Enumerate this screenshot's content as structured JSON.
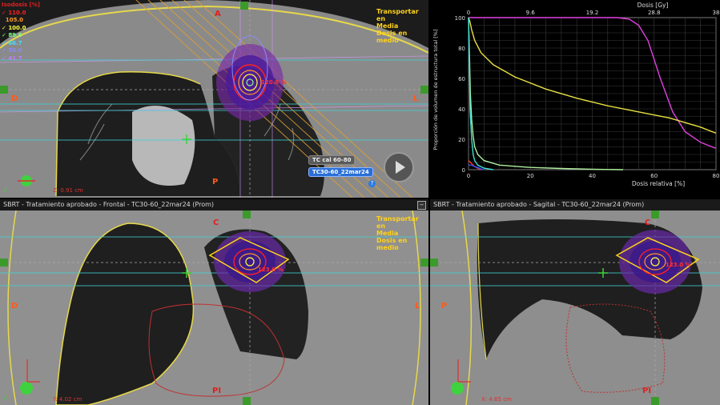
{
  "panels": {
    "axial": {
      "title": "",
      "legend_title": "Isodosis [%]",
      "isodose_levels": [
        {
          "label": "110.0",
          "color": "#ff2020"
        },
        {
          "label": "105.0",
          "color": "#ff9a2a"
        },
        {
          "label": "100.0",
          "color": "#ffff40"
        },
        {
          "label": "89.6",
          "color": "#80ff80"
        },
        {
          "label": "66.7",
          "color": "#40e0ff"
        },
        {
          "label": "50.0",
          "color": "#8a8aff"
        },
        {
          "label": "41.7",
          "color": "#c080ff"
        }
      ],
      "info_lines": [
        "Transportar en",
        "Media",
        "Dosis en medio"
      ],
      "orientation": {
        "top": "A",
        "left": "D",
        "right": "L",
        "bottom": "P"
      },
      "dose_value": "120.8 %",
      "position": "Z: 0.91 cm",
      "ct_tag": "TC cal 60-80",
      "plan_tag": "TC30-60_22mar24"
    },
    "frontal": {
      "title": "SBRT  -  Tratamiento aprobado - Frontal - TC30-60_22mar24 (Prom)",
      "info_lines": [
        "Transportar en",
        "Media",
        "Dosis en medio"
      ],
      "orientation": {
        "top": "C",
        "left": "D",
        "right": "L",
        "bottom": "PI"
      },
      "dose_value": "123.0 %",
      "position": "Y: 4.02 cm"
    },
    "sagital": {
      "title": "SBRT  -  Tratamiento aprobado - Sagital - TC30-60_22mar24 (Prom)",
      "orientation": {
        "top": "C",
        "left": "P",
        "bottom": "PI"
      },
      "dose_value": "123.0 %",
      "position": "X: 4.65 cm"
    }
  },
  "chart_data": {
    "type": "line",
    "title": "",
    "top_axis_label": "Dosis [Gy]",
    "top_ticks": [
      "0",
      "9.6",
      "19.2",
      "28.8",
      "38"
    ],
    "xlabel": "Dosis relativa [%]",
    "x_ticks": [
      "0",
      "20",
      "40",
      "60",
      "80"
    ],
    "ylabel": "Proporción de volumen de estructura total [%]",
    "y_ticks": [
      "0",
      "20",
      "40",
      "60",
      "80",
      "100"
    ],
    "xlim": [
      0,
      80
    ],
    "ylim": [
      0,
      100
    ],
    "grid": true,
    "series": [
      {
        "color": "#e040e0",
        "x": [
          0,
          45,
          48,
          52,
          55,
          58,
          62,
          66,
          70,
          75,
          80
        ],
        "y": [
          100,
          100,
          100,
          99,
          95,
          85,
          60,
          38,
          25,
          18,
          14
        ]
      },
      {
        "color": "#e8e040",
        "x": [
          0,
          0.5,
          1,
          2,
          4,
          8,
          15,
          25,
          35,
          45,
          55,
          65,
          75,
          80
        ],
        "y": [
          100,
          97,
          92,
          85,
          77,
          69,
          61,
          53,
          47,
          42,
          38,
          34,
          28,
          24
        ]
      },
      {
        "color": "#b0f0a0",
        "x": [
          0,
          0.3,
          0.6,
          1,
          1.5,
          2,
          3,
          5,
          10,
          20,
          30,
          40,
          50
        ],
        "y": [
          100,
          75,
          50,
          33,
          22,
          15,
          10,
          6,
          3,
          1.5,
          0.8,
          0.3,
          0
        ]
      },
      {
        "color": "#40e0d0",
        "x": [
          0,
          0.5,
          1,
          1.5,
          2,
          3,
          5,
          8
        ],
        "y": [
          100,
          40,
          20,
          10,
          6,
          3,
          1,
          0
        ]
      },
      {
        "color": "#ff3030",
        "x": [
          0,
          1,
          2,
          3,
          4
        ],
        "y": [
          6,
          4,
          2,
          1,
          0
        ]
      },
      {
        "color": "#3050ff",
        "x": [
          0,
          1,
          2,
          3,
          4,
          5
        ],
        "y": [
          3,
          3,
          2,
          1.5,
          0.5,
          0
        ]
      }
    ]
  }
}
